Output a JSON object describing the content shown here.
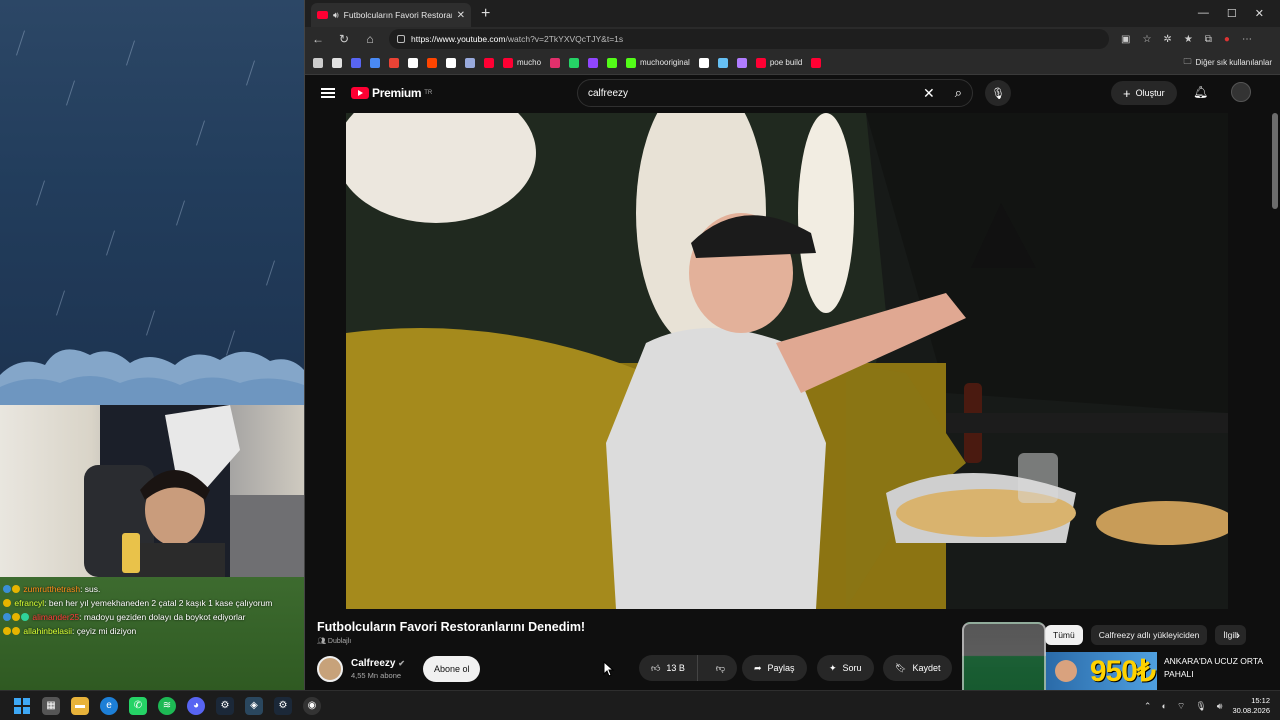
{
  "chat": [
    {
      "user": "zumrutthetrash",
      "message": ": sus.",
      "user_color": "#ff8c1a"
    },
    {
      "user": "efrancyl",
      "message": ": ben her yıl yemekhaneden 2 çatal 2 kaşık 1 kase çalıyorum",
      "user_color": "#d9ff33"
    },
    {
      "user": "alimander25",
      "message": ": madoyu geziden dolayı da boykot ediyorlar",
      "user_color": "#ff3b3b"
    },
    {
      "user": "allahinbelasii",
      "message": ": çeyiz mi diziyon",
      "user_color": "#d9ff33"
    }
  ],
  "browser": {
    "tab_title": "Futbolcuların Favori Restoranl",
    "url_domain": "https://www.youtube.com",
    "url_path": "/watch?v=2TkYXVQcTJY&t=1s",
    "bookmarks": [
      {
        "label": "",
        "icon": "mail-icon",
        "color": "#e0e0e0"
      },
      {
        "label": "",
        "icon": "discord-icon",
        "color": "#5865f2"
      },
      {
        "label": "",
        "icon": "translate-icon",
        "color": "#4a8af4"
      },
      {
        "label": "",
        "icon": "gmail-icon",
        "color": "#ea4335"
      },
      {
        "label": "",
        "icon": "google-icon",
        "color": "#ffffff"
      },
      {
        "label": "",
        "icon": "reddit-icon",
        "color": "#ff4500"
      },
      {
        "label": "",
        "icon": "x-icon",
        "color": "#ffffff"
      },
      {
        "label": "",
        "icon": "tool-icon",
        "color": "#9ad"
      },
      {
        "label": "",
        "icon": "youtube-icon",
        "color": "#ff0033"
      },
      {
        "label": "mucho",
        "icon": "youtube-icon",
        "color": "#ff0033"
      },
      {
        "label": "",
        "icon": "instagram-icon",
        "color": "#e1306c"
      },
      {
        "label": "",
        "icon": "whatsapp-icon",
        "color": "#25d366"
      },
      {
        "label": "",
        "icon": "twitch-icon",
        "color": "#9146ff"
      },
      {
        "label": "",
        "icon": "pinwheel-icon",
        "color": "#53fc18"
      },
      {
        "label": "muchooriginal",
        "icon": "kick-icon",
        "color": "#53fc18"
      },
      {
        "label": "",
        "icon": "openai-icon",
        "color": "#ffffff"
      },
      {
        "label": "",
        "icon": "steam-icon",
        "color": "#66c0f4"
      },
      {
        "label": "",
        "icon": "feather-icon",
        "color": "#b07cff"
      },
      {
        "label": "poe build",
        "icon": "youtube-icon",
        "color": "#ff0033"
      },
      {
        "label": "",
        "icon": "youtube-icon",
        "color": "#ff0033"
      }
    ],
    "other_bookmarks": "Diğer sık kullanılanlar"
  },
  "youtube": {
    "logo_text": "Premium",
    "logo_region": "TR",
    "search_value": "calfreezy",
    "create_label": "Oluştur",
    "video_title": "Futbolcuların Favori Restoranlarını Denedim!",
    "dub_label": "Dublajlı",
    "channel_name": "Calfreezy",
    "channel_subs": "4,55 Mn abone",
    "subscribe_label": "Abone ol",
    "likes": "13 B",
    "share_label": "Paylaş",
    "ask_label": "Soru",
    "save_label": "Kaydet",
    "chips": [
      "Tümü",
      "Calfreezy adlı yükleyiciden",
      "İlgili"
    ],
    "rec_thumb_text": "950₺",
    "rec_title": "ANKARA'DA UCUZ ORTA PAHALI"
  },
  "taskbar": {
    "time": "15:12",
    "date": "30.08.2026"
  }
}
